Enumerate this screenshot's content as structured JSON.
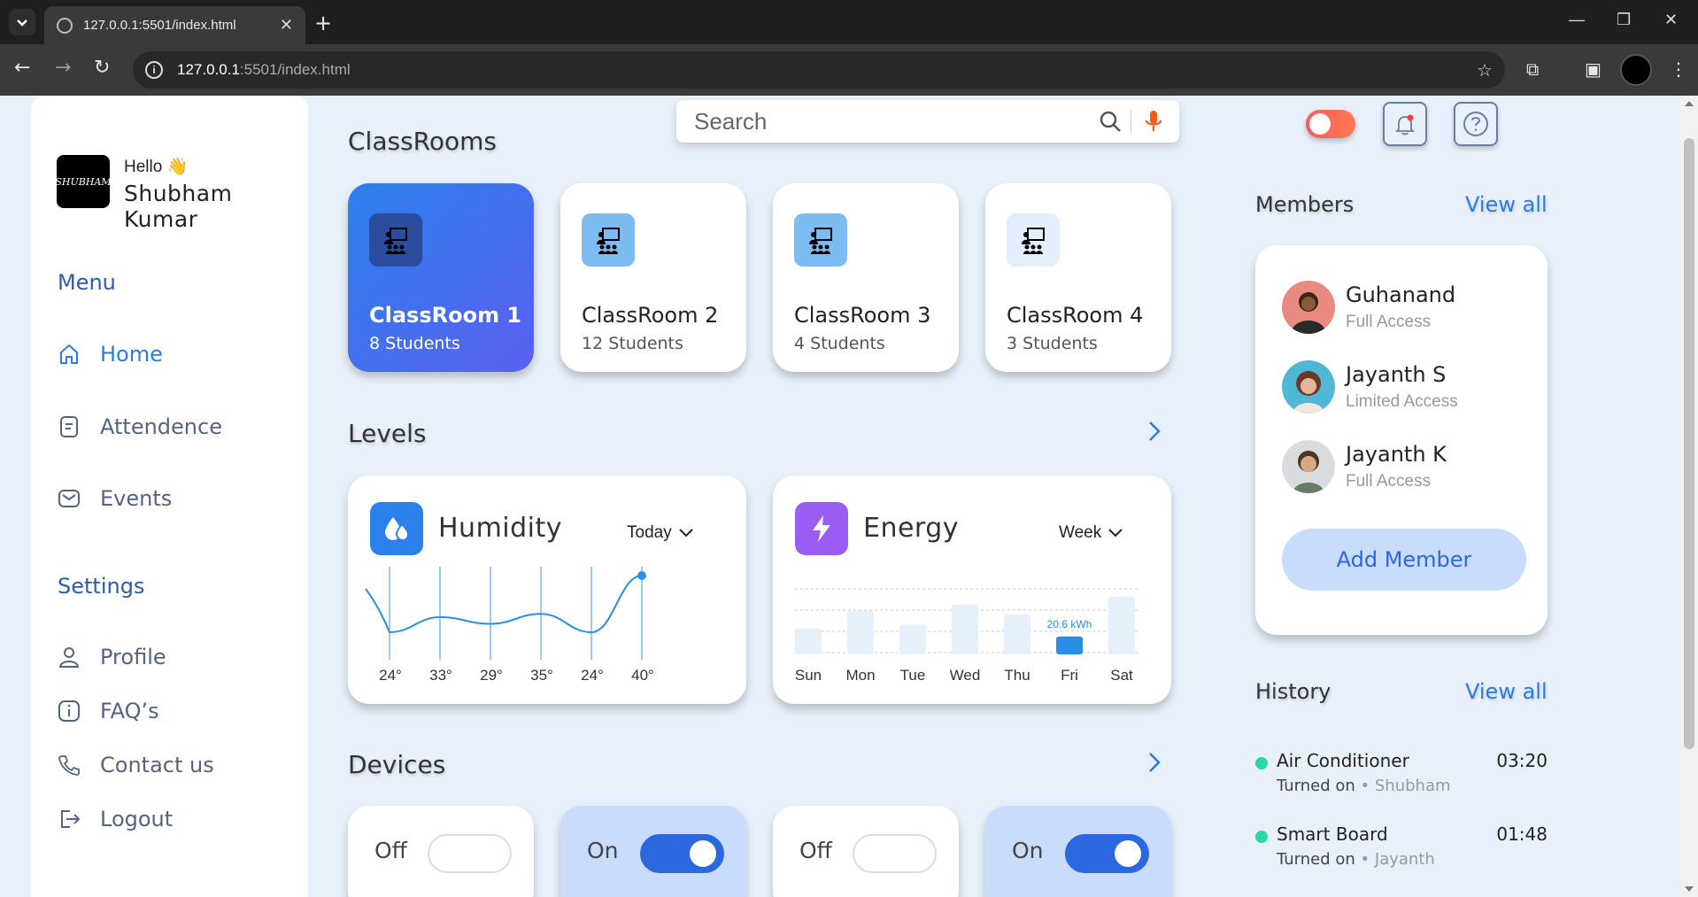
{
  "browser": {
    "tab_title": "127.0.0.1:5501/index.html",
    "url_host": "127.0.0.1",
    "url_path": ":5501/index.html"
  },
  "sidebar": {
    "greeting": "Hello 👋",
    "user_name": "Shubham Kumar",
    "logo_text": "SHUBHAM",
    "menu_heading": "Menu",
    "menu": [
      {
        "label": "Home",
        "icon": "home-icon",
        "active": true
      },
      {
        "label": "Attendence",
        "icon": "document-icon"
      },
      {
        "label": "Events",
        "icon": "mail-icon"
      }
    ],
    "settings_heading": "Settings",
    "settings": [
      {
        "label": "Profile",
        "icon": "user-icon"
      },
      {
        "label": "FAQ’s",
        "icon": "info-icon"
      },
      {
        "label": "Contact us",
        "icon": "phone-icon"
      },
      {
        "label": "Logout",
        "icon": "logout-icon"
      }
    ]
  },
  "search": {
    "placeholder": "Search"
  },
  "classrooms": {
    "heading": "ClassRooms",
    "items": [
      {
        "name": "ClassRoom 1",
        "students": "8 Students",
        "active": true
      },
      {
        "name": "ClassRoom 2",
        "students": "12 Students"
      },
      {
        "name": "ClassRoom 3",
        "students": "4 Students"
      },
      {
        "name": "ClassRoom 4",
        "students": "3 Students"
      }
    ]
  },
  "levels": {
    "heading": "Levels",
    "humidity": {
      "title": "Humidity",
      "period": "Today",
      "ticks": [
        "24°",
        "33°",
        "29°",
        "35°",
        "24°",
        "40°"
      ]
    },
    "energy": {
      "title": "Energy",
      "period": "Week",
      "days": [
        "Sun",
        "Mon",
        "Tue",
        "Wed",
        "Thu",
        "Fri",
        "Sat"
      ],
      "highlight_label": "20.6 kWh"
    }
  },
  "chart_data": [
    {
      "type": "line",
      "x": [
        "24°",
        "33°",
        "29°",
        "35°",
        "24°",
        "40°"
      ],
      "values": [
        24,
        33,
        29,
        35,
        24,
        40
      ]
    },
    {
      "type": "bar",
      "categories": [
        "Sun",
        "Mon",
        "Tue",
        "Wed",
        "Thu",
        "Fri",
        "Sat"
      ],
      "values": [
        13,
        22,
        15,
        25,
        20,
        9,
        29
      ],
      "highlight": "Fri",
      "highlight_label": "20.6 kWh"
    }
  ],
  "devices": {
    "heading": "Devices",
    "items": [
      {
        "state": "Off",
        "on": false
      },
      {
        "state": "On",
        "on": true
      },
      {
        "state": "Off",
        "on": false
      },
      {
        "state": "On",
        "on": true
      }
    ]
  },
  "members": {
    "heading": "Members",
    "view_all": "View all",
    "items": [
      {
        "name": "Guhanand",
        "access": "Full Access"
      },
      {
        "name": "Jayanth S",
        "access": "Limited Access"
      },
      {
        "name": "Jayanth K",
        "access": "Full Access"
      }
    ],
    "add_label": "Add Member"
  },
  "history": {
    "heading": "History",
    "view_all": "View all",
    "items": [
      {
        "device": "Air Conditioner",
        "time": "03:20",
        "status": "Turned on",
        "by": "• Shubham"
      },
      {
        "device": "Smart Board",
        "time": "01:48",
        "status": "Turned on",
        "by": "• Jayanth"
      }
    ]
  },
  "colors": {
    "accent": "#2b7be3",
    "background": "#e8f1fb",
    "history_dot": "#2ed7a4",
    "toggle": "#ff5a5a"
  }
}
